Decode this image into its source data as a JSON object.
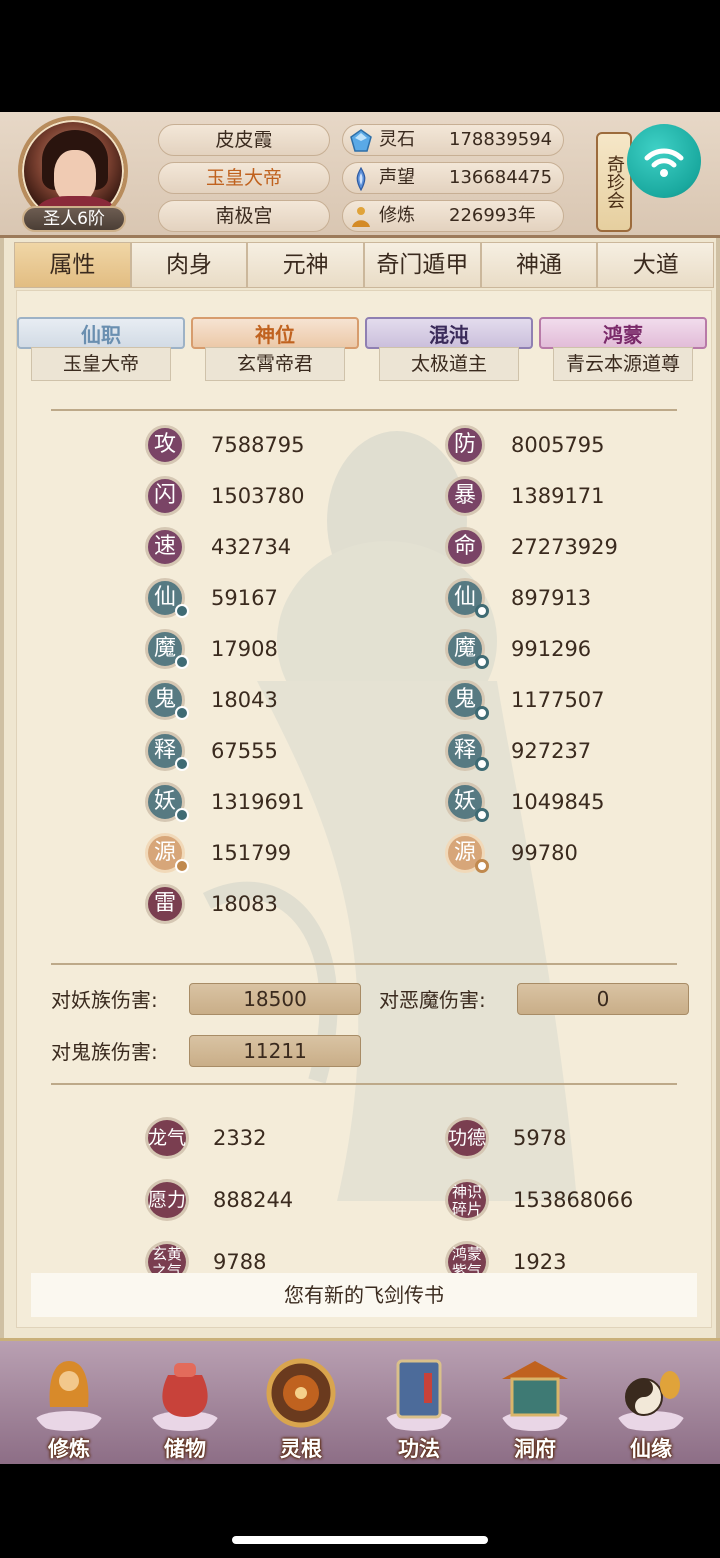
{
  "player": {
    "rank": "圣人6阶",
    "name": "皮皮霞",
    "title": "玉皇大帝",
    "palace": "南极宫"
  },
  "resources": [
    {
      "label": "灵石",
      "value": "178839594",
      "icon": "spirit-stone-icon"
    },
    {
      "label": "声望",
      "value": "136684475",
      "icon": "reputation-icon"
    },
    {
      "label": "修炼",
      "value": "226993年",
      "icon": "cultivation-icon"
    }
  ],
  "qizhen_label": "奇珍会",
  "tabs": [
    "属性",
    "肉身",
    "元神",
    "奇门遁甲",
    "神通",
    "大道"
  ],
  "active_tab": 0,
  "titles": [
    {
      "banner": "仙职",
      "value": "玉皇大帝",
      "color": "#6a8fb0"
    },
    {
      "banner": "神位",
      "value": "玄霄帝君",
      "color": "#c0621f"
    },
    {
      "banner": "混沌",
      "value": "太极道主",
      "color": "#3a2a5a"
    },
    {
      "banner": "鸿蒙",
      "value": "青云本源道尊",
      "color": "#7a2a6a"
    }
  ],
  "stats_left": [
    {
      "char": "攻",
      "value": "7588795"
    },
    {
      "char": "闪",
      "value": "1503780"
    },
    {
      "char": "速",
      "value": "432734"
    },
    {
      "char": "仙",
      "value": "59167"
    },
    {
      "char": "魔",
      "value": "17908"
    },
    {
      "char": "鬼",
      "value": "18043"
    },
    {
      "char": "释",
      "value": "67555"
    },
    {
      "char": "妖",
      "value": "1319691"
    },
    {
      "char": "源",
      "value": "151799"
    },
    {
      "char": "雷",
      "value": "18083"
    }
  ],
  "stats_right": [
    {
      "char": "防",
      "value": "8005795"
    },
    {
      "char": "暴",
      "value": "1389171"
    },
    {
      "char": "命",
      "value": "27273929"
    },
    {
      "char": "仙",
      "value": "897913"
    },
    {
      "char": "魔",
      "value": "991296"
    },
    {
      "char": "鬼",
      "value": "1177507"
    },
    {
      "char": "释",
      "value": "927237"
    },
    {
      "char": "妖",
      "value": "1049845"
    },
    {
      "char": "源",
      "value": "99780"
    }
  ],
  "damage": {
    "yao_label": "对妖族伤害:",
    "yao_value": "18500",
    "emo_label": "对恶魔伤害:",
    "emo_value": "0",
    "gui_label": "对鬼族伤害:",
    "gui_value": "11211"
  },
  "special": [
    {
      "char": "龙气",
      "value": "2332"
    },
    {
      "char": "功德",
      "value": "5978"
    },
    {
      "char": "愿力",
      "value": "888244"
    },
    {
      "char": "神识碎片",
      "value": "153868066"
    },
    {
      "char": "玄黄之气",
      "value": "9788"
    },
    {
      "char": "鸿蒙紫气",
      "value": "1923"
    }
  ],
  "notice": "您有新的飞剑传书",
  "nav": [
    "修炼",
    "储物",
    "灵根",
    "功法",
    "洞府",
    "仙缘"
  ]
}
